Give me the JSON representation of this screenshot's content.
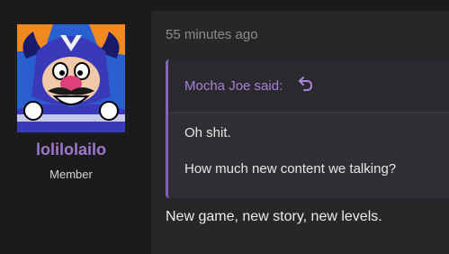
{
  "user": {
    "name": "lolilolailo",
    "title": "Member",
    "avatar_icon": "cartoon-villain-avatar"
  },
  "post": {
    "timestamp": "55 minutes ago",
    "quote": {
      "author_line": "Mocha Joe said:",
      "reply_icon": "reply-arrow-icon",
      "line1": "Oh shit.",
      "line2": "How much new content we talking?"
    },
    "message": "New game, new story, new levels."
  },
  "colors": {
    "background": "#1b1b1d",
    "post_background": "#27272a",
    "accent": "#9f78cc",
    "quote_border": "#8a5fc2"
  }
}
